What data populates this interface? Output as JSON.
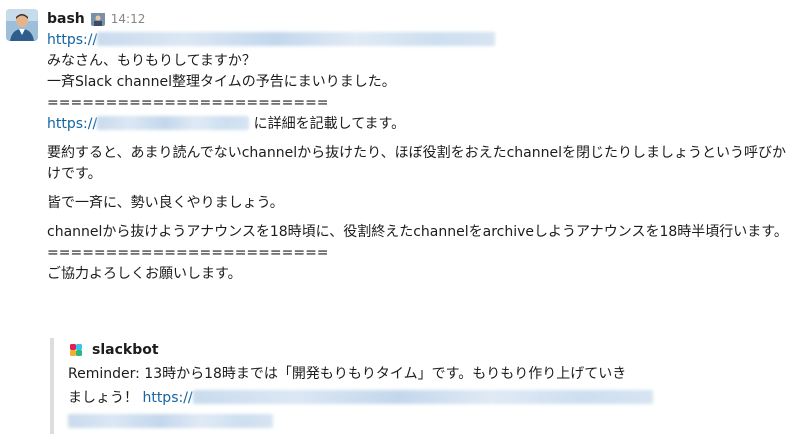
{
  "message": {
    "author": "bash",
    "time": "14:12",
    "link_prefix": "https://",
    "line_greeting": "みなさん、もりもりしてますか？",
    "line_announce": "一斉Slack channel整理タイムの予告にまいりました。",
    "divider": "========================",
    "detail_suffix": "に詳細を記載してます。",
    "summary": "要約すると、あまり読んでないchannelから抜けたり、ほぼ役割をおえたchannelを閉じたりしましょうという呼びかけです。",
    "cheer": "皆で一斉に、勢い良くやりましょう。",
    "schedule": "channelから抜けようアナウンスを18時頃に、役割終えたchannelをarchiveしようアナウンスを18時半頃行います。",
    "closing": "ご協力よろしくお願いします。"
  },
  "attachment": {
    "bot_name": "slackbot",
    "line1": "Reminder: 13時から18時までは「開発もりもりタイム」です。もりもり作り上げていき",
    "line2_prefix": "ましょう！",
    "link_prefix": "https://"
  }
}
